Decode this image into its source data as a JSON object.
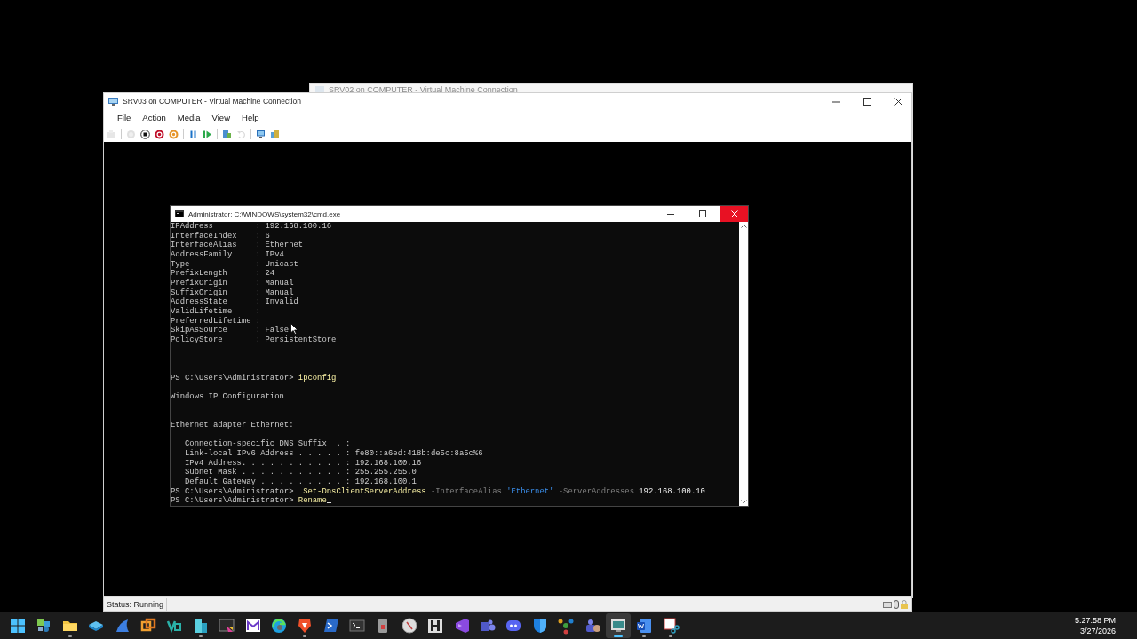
{
  "background_window": {
    "title": "SRV02 on COMPUTER - Virtual Machine Connection"
  },
  "vm_window": {
    "title": "SRV03 on COMPUTER - Virtual Machine Connection",
    "menu": [
      "File",
      "Action",
      "Media",
      "View",
      "Help"
    ],
    "toolbar": [
      {
        "disabled": true
      },
      {
        "disabled": true
      },
      {
        "disabled": false
      },
      {
        "disabled": false
      },
      {
        "disabled": false
      },
      {
        "disabled": false
      },
      {
        "disabled": false
      },
      {
        "disabled": false
      },
      {
        "disabled": true
      },
      {
        "disabled": false
      },
      {
        "disabled": false
      }
    ],
    "status": "Status: Running"
  },
  "console": {
    "title": "Administrator: C:\\WINDOWS\\system32\\cmd.exe",
    "lines": [
      {
        "kind": "text",
        "segments": [
          {
            "kind": "output",
            "text": "IPAddress         : 192.168.100.16"
          }
        ]
      },
      {
        "kind": "text",
        "segments": [
          {
            "kind": "output",
            "text": "InterfaceIndex    : 6"
          }
        ]
      },
      {
        "kind": "text",
        "segments": [
          {
            "kind": "output",
            "text": "InterfaceAlias    : Ethernet"
          }
        ]
      },
      {
        "kind": "text",
        "segments": [
          {
            "kind": "output",
            "text": "AddressFamily     : IPv4"
          }
        ]
      },
      {
        "kind": "text",
        "segments": [
          {
            "kind": "output",
            "text": "Type              : Unicast"
          }
        ]
      },
      {
        "kind": "text",
        "segments": [
          {
            "kind": "output",
            "text": "PrefixLength      : 24"
          }
        ]
      },
      {
        "kind": "text",
        "segments": [
          {
            "kind": "output",
            "text": "PrefixOrigin      : Manual"
          }
        ]
      },
      {
        "kind": "text",
        "segments": [
          {
            "kind": "output",
            "text": "SuffixOrigin      : Manual"
          }
        ]
      },
      {
        "kind": "text",
        "segments": [
          {
            "kind": "output",
            "text": "AddressState      : Invalid"
          }
        ]
      },
      {
        "kind": "text",
        "segments": [
          {
            "kind": "output",
            "text": "ValidLifetime     :"
          }
        ]
      },
      {
        "kind": "text",
        "segments": [
          {
            "kind": "output",
            "text": "PreferredLifetime :"
          }
        ]
      },
      {
        "kind": "text",
        "segments": [
          {
            "kind": "output",
            "text": "SkipAsSource      : False"
          }
        ]
      },
      {
        "kind": "text",
        "segments": [
          {
            "kind": "output",
            "text": "PolicyStore       : PersistentStore"
          }
        ]
      },
      {
        "kind": "blank"
      },
      {
        "kind": "blank"
      },
      {
        "kind": "blank"
      },
      {
        "kind": "text",
        "segments": [
          {
            "kind": "prompt",
            "text": "PS C:\\Users\\Administrator>"
          },
          {
            "kind": "command",
            "text": " ipconfig"
          }
        ]
      },
      {
        "kind": "blank"
      },
      {
        "kind": "text",
        "segments": [
          {
            "kind": "output",
            "text": "Windows IP Configuration"
          }
        ]
      },
      {
        "kind": "blank"
      },
      {
        "kind": "blank"
      },
      {
        "kind": "text",
        "segments": [
          {
            "kind": "output",
            "text": "Ethernet adapter Ethernet:"
          }
        ]
      },
      {
        "kind": "blank"
      },
      {
        "kind": "text",
        "segments": [
          {
            "kind": "output",
            "text": "   Connection-specific DNS Suffix  . :"
          }
        ]
      },
      {
        "kind": "text",
        "segments": [
          {
            "kind": "output",
            "text": "   Link-local IPv6 Address . . . . . : fe80::a6ed:418b:de5c:8a5c%6"
          }
        ]
      },
      {
        "kind": "text",
        "segments": [
          {
            "kind": "output",
            "text": "   IPv4 Address. . . . . . . . . . . : 192.168.100.16"
          }
        ]
      },
      {
        "kind": "text",
        "segments": [
          {
            "kind": "output",
            "text": "   Subnet Mask . . . . . . . . . . . : 255.255.255.0"
          }
        ]
      },
      {
        "kind": "text",
        "segments": [
          {
            "kind": "output",
            "text": "   Default Gateway . . . . . . . . . : 192.168.100.1"
          }
        ]
      },
      {
        "kind": "text",
        "segments": [
          {
            "kind": "prompt",
            "text": "PS C:\\Users\\Administrator>"
          },
          {
            "kind": "command",
            "text": "  Set-DnsClientServerAddress"
          },
          {
            "kind": "parameter",
            "text": " -InterfaceAlias"
          },
          {
            "kind": "string",
            "text": " 'Ethernet'"
          },
          {
            "kind": "parameter",
            "text": " -ServerAddresses"
          },
          {
            "kind": "value",
            "text": " 192.168.100.10"
          }
        ]
      },
      {
        "kind": "text",
        "caret": true,
        "segments": [
          {
            "kind": "prompt",
            "text": "PS C:\\Users\\Administrator>"
          },
          {
            "kind": "command",
            "text": " Rename"
          }
        ]
      }
    ]
  },
  "taskbar": {
    "apps": [
      {
        "running": false,
        "selected": false
      },
      {
        "running": false,
        "selected": false
      },
      {
        "running": true,
        "selected": false
      },
      {
        "running": false,
        "selected": false
      },
      {
        "running": false,
        "selected": false
      },
      {
        "running": false,
        "selected": false
      },
      {
        "running": false,
        "selected": false
      },
      {
        "running": true,
        "selected": false
      },
      {
        "running": false,
        "selected": false
      },
      {
        "running": false,
        "selected": false
      },
      {
        "running": false,
        "selected": false
      },
      {
        "running": true,
        "selected": false
      },
      {
        "running": false,
        "selected": false
      },
      {
        "running": false,
        "selected": false
      },
      {
        "running": false,
        "selected": false
      },
      {
        "running": false,
        "selected": false
      },
      {
        "running": false,
        "selected": false
      },
      {
        "running": false,
        "selected": false
      },
      {
        "running": false,
        "selected": false
      },
      {
        "running": false,
        "selected": false
      },
      {
        "running": false,
        "selected": false
      },
      {
        "running": false,
        "selected": false
      },
      {
        "running": false,
        "selected": false
      },
      {
        "running": true,
        "selected": true
      },
      {
        "running": true,
        "selected": false
      },
      {
        "running": true,
        "selected": false
      }
    ],
    "time": "5:27:58 PM",
    "date": "3/27/2026"
  }
}
